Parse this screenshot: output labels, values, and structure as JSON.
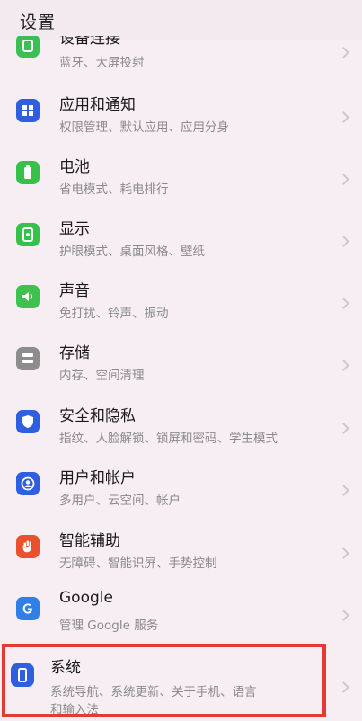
{
  "header": {
    "title": "设置"
  },
  "items": [
    {
      "label": "设备连接",
      "sub": "蓝牙、大屏投射",
      "icon": "device-connect-icon",
      "color": "#3bbf55"
    },
    {
      "label": "应用和通知",
      "sub": "权限管理、默认应用、应用分身",
      "icon": "apps-icon",
      "color": "#2f5fe0"
    },
    {
      "label": "电池",
      "sub": "省电模式、耗电排行",
      "icon": "battery-icon",
      "color": "#36c24a"
    },
    {
      "label": "显示",
      "sub": "护眼模式、桌面风格、壁纸",
      "icon": "display-icon",
      "color": "#36c24a"
    },
    {
      "label": "声音",
      "sub": "免打扰、铃声、振动",
      "icon": "sound-icon",
      "color": "#3ec24f"
    },
    {
      "label": "存储",
      "sub": "内存、空间清理",
      "icon": "storage-icon",
      "color": "#8d8d8d"
    },
    {
      "label": "安全和隐私",
      "sub": "指纹、人脸解锁、锁屏和密码、学生模式",
      "icon": "shield-icon",
      "color": "#2f5fe0"
    },
    {
      "label": "用户和帐户",
      "sub": "多用户、云空间、帐户",
      "icon": "user-icon",
      "color": "#2f5fe0"
    },
    {
      "label": "智能辅助",
      "sub": "无障碍、智能识屏、手势控制",
      "icon": "hand-icon",
      "color": "#e8502e"
    },
    {
      "label": "Google",
      "sub": "管理 Google 服务",
      "icon": "google-icon",
      "color": "#2f7fe6"
    },
    {
      "label": "系统",
      "sub": "系统导航、系统更新、关于手机、语言",
      "sub2": "和输入法",
      "icon": "phone-icon",
      "color": "#2f5fe0"
    }
  ]
}
